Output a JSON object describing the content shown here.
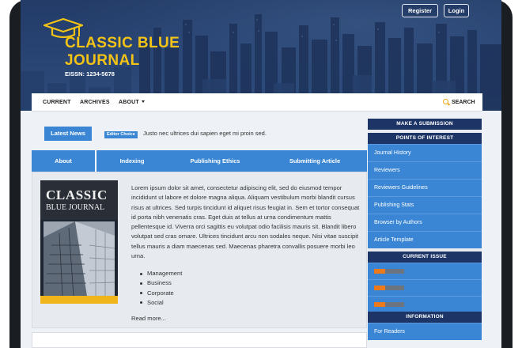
{
  "header": {
    "register_label": "Register",
    "login_label": "Login",
    "logo_line1": "CLASSIC BLUE",
    "logo_line2": "JOURNAL",
    "eissn": "EISSN: 1234-5678",
    "logo_color": "#f3c316"
  },
  "nav": {
    "items": [
      {
        "label": "CURRENT"
      },
      {
        "label": "ARCHIVES"
      },
      {
        "label": "ABOUT"
      }
    ],
    "search_label": "SEARCH"
  },
  "news": {
    "latest_label": "Latest News",
    "badge": "Editor Choice",
    "headline": "Justo nec ultrices dui sapien eget mi proin sed."
  },
  "tabs": [
    {
      "label": "About"
    },
    {
      "label": "Indexing"
    },
    {
      "label": "Publishing Ethics"
    },
    {
      "label": "Submitting Article"
    }
  ],
  "article": {
    "cover_title_1": "CLASSIC",
    "cover_title_2": "BLUE JOURNAL",
    "body": "Lorem ipsum dolor sit amet, consectetur adipiscing elit, sed do eiusmod tempor incididunt ut labore et dolore magna aliqua. Aliquam vestibulum morbi blandit cursus risus at ultrices. Sed turpis tincidunt id aliquet risus feugiat in. Sem et tortor consequat id porta nibh venenatis cras. Eget duis at tellus at urna condimentum mattis pellentesque id. Viverra orci sagittis eu volutpat odio facilisis mauris sit. Blandit libero volutpat sed cras ornare. Ultrices tincidunt arcu non sodales neque. Nisi vitae suscipit tellus mauris a diam maecenas sed. Maecenas pharetra convallis posuere morbi leo urna.",
    "topics": [
      "Management",
      "Business",
      "Corporate",
      "Social"
    ],
    "read_more": "Read more..."
  },
  "sidebar": {
    "submission_title": "MAKE A SUBMISSION",
    "poi_title": "POINTS OF INTEREST",
    "poi_items": [
      {
        "label": "Journal History"
      },
      {
        "label": "Reviewers"
      },
      {
        "label": "Reviewers Guidelines"
      },
      {
        "label": "Publishing Stats"
      },
      {
        "label": "Browser by Authors"
      },
      {
        "label": "Article Template"
      }
    ],
    "current_issue_title": "CURRENT ISSUE",
    "information_title": "INFORMATION",
    "info_items": [
      {
        "label": "For Readers"
      }
    ]
  },
  "colors": {
    "primary_blue": "#3a86d4",
    "dark_navy": "#1c3466",
    "accent_gold": "#f3c316"
  }
}
